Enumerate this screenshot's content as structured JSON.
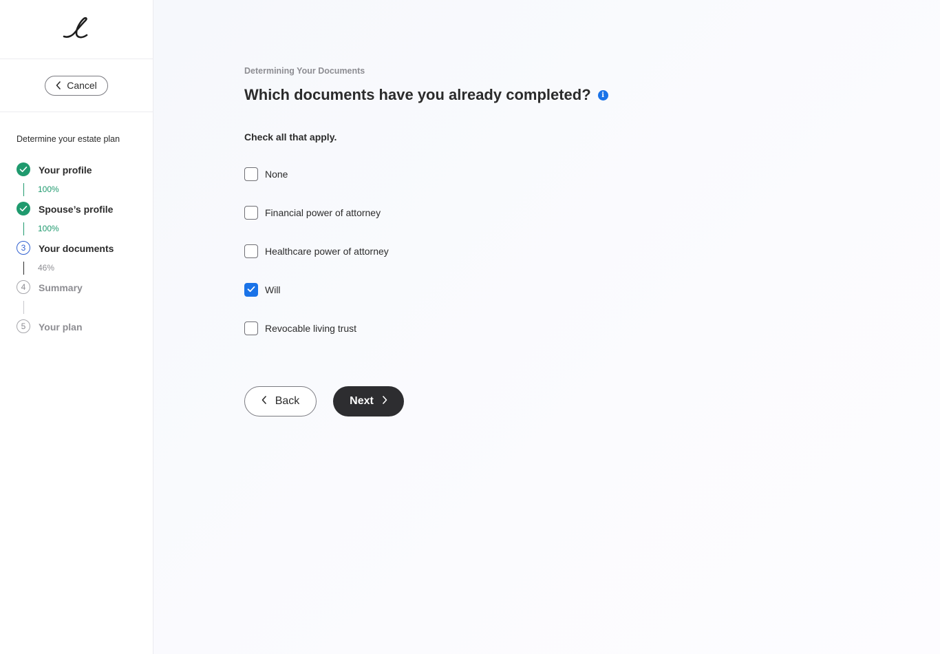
{
  "sidebar": {
    "logo_icon": "script-e-logo",
    "cancel_label": "Cancel",
    "plan_title": "Determine your estate plan",
    "steps": [
      {
        "number": "",
        "label": "Your profile",
        "progress": "100%",
        "status": "done"
      },
      {
        "number": "",
        "label": "Spouse’s profile",
        "progress": "100%",
        "status": "done"
      },
      {
        "number": "3",
        "label": "Your documents",
        "progress": "46%",
        "status": "current"
      },
      {
        "number": "4",
        "label": "Summary",
        "progress": "",
        "status": "todo"
      },
      {
        "number": "5",
        "label": "Your plan",
        "progress": "",
        "status": "todo"
      }
    ]
  },
  "main": {
    "eyebrow": "Determining Your Documents",
    "question": "Which documents have you already completed?",
    "info_icon_glyph": "i",
    "hint": "Check all that apply.",
    "options": [
      {
        "label": "None",
        "checked": false
      },
      {
        "label": "Financial power of attorney",
        "checked": false
      },
      {
        "label": "Healthcare power of attorney",
        "checked": false
      },
      {
        "label": "Will",
        "checked": true
      },
      {
        "label": "Revocable living trust",
        "checked": false
      }
    ],
    "back_label": "Back",
    "next_label": "Next"
  },
  "colors": {
    "accent_blue": "#1a73e8",
    "done_green": "#1f9a6e",
    "current_blue": "#2f5fd0",
    "primary_button": "#2d2d30"
  }
}
